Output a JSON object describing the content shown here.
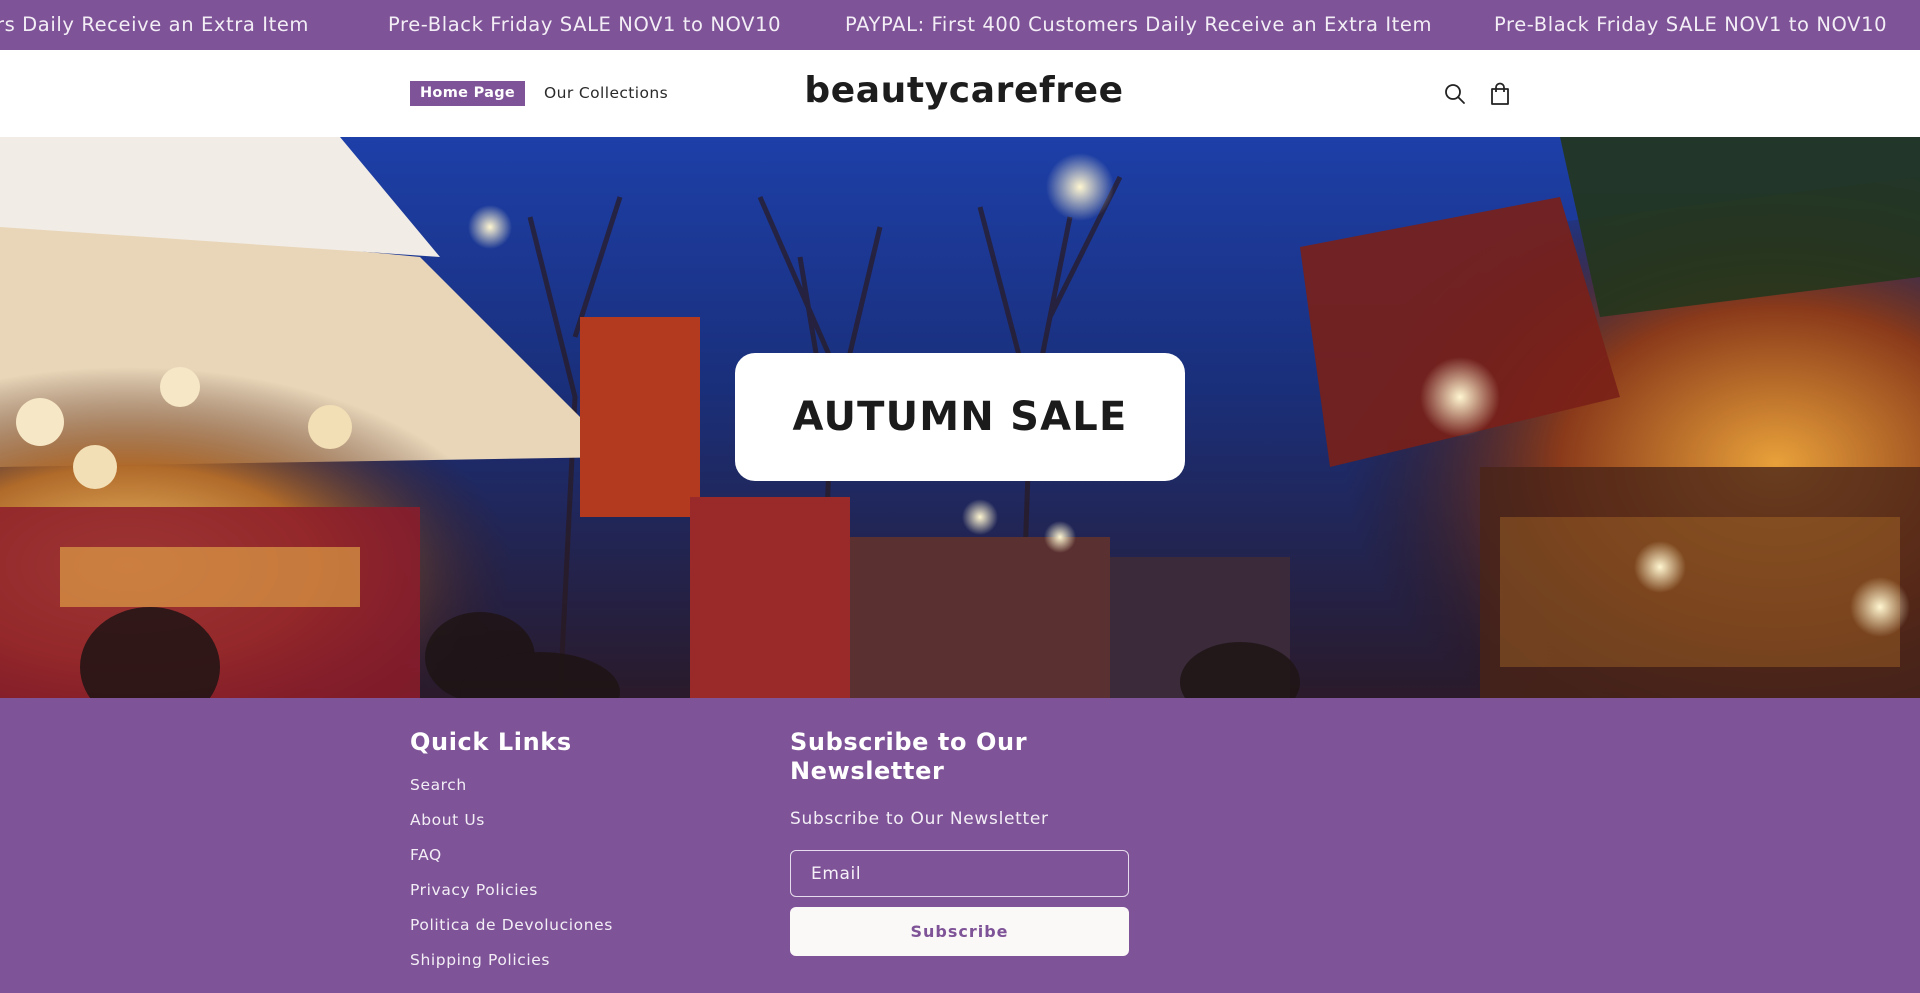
{
  "announcement": {
    "messages": [
      "rs Daily Receive an Extra Item",
      "Pre-Black Friday SALE NOV1 to NOV10",
      "PAYPAL: First 400 Customers Daily Receive an Extra Item",
      "Pre-Black Friday SALE NOV1 to NOV10"
    ]
  },
  "header": {
    "nav": {
      "home": "Home Page",
      "collections": "Our Collections"
    },
    "brand": "beautycarefree",
    "icons": [
      "search-icon",
      "cart-icon"
    ]
  },
  "hero": {
    "title": "AUTUMN SALE"
  },
  "footer": {
    "quick_links": {
      "heading": "Quick Links",
      "links": [
        "Search",
        "About Us",
        "FAQ",
        "Privacy Policies",
        "Politica de Devoluciones",
        "Shipping Policies"
      ]
    },
    "newsletter": {
      "heading": "Subscribe to Our Newsletter",
      "subheading": "Subscribe to Our Newsletter",
      "email_placeholder": "Email",
      "button": "Subscribe"
    }
  },
  "colors": {
    "brand_purple": "#7e5397",
    "button_bg": "#fbf9f7"
  }
}
